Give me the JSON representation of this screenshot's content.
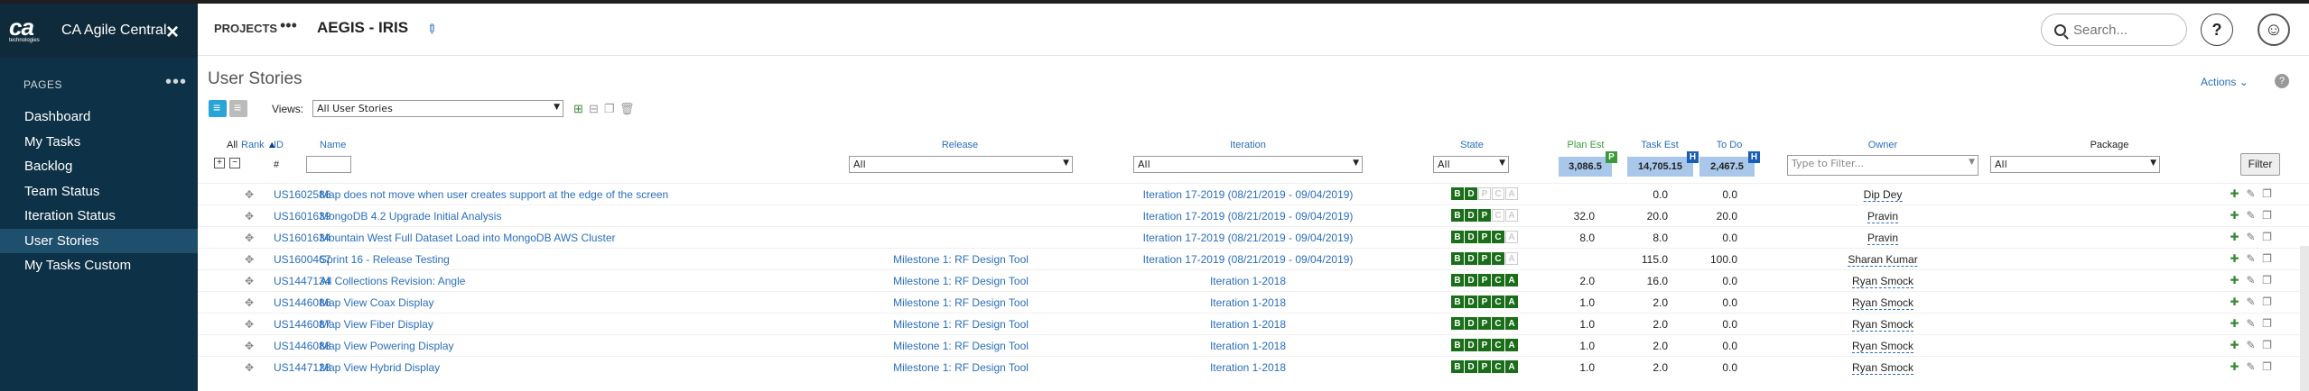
{
  "app": {
    "name": "CA Agile Central",
    "logo_text": "ca",
    "logo_subtext": "technologies"
  },
  "sidebar": {
    "heading": "PAGES",
    "items": [
      {
        "label": "Dashboard"
      },
      {
        "label": "My Tasks"
      },
      {
        "label": "Backlog"
      },
      {
        "label": "Team Status"
      },
      {
        "label": "Iteration Status"
      },
      {
        "label": "User Stories",
        "active": true
      },
      {
        "label": "My Tasks Custom"
      }
    ]
  },
  "header": {
    "projects_label": "PROJECTS",
    "project_title": "AEGIS - IRIS",
    "search_placeholder": "Search...",
    "help_label": "?"
  },
  "main": {
    "title": "User Stories",
    "actions_label": "Actions",
    "views_label": "Views:",
    "views_value": "All User Stories"
  },
  "columns": {
    "all": "All",
    "rank": "Rank",
    "id": "ID",
    "name": "Name",
    "release": "Release",
    "iteration": "Iteration",
    "state": "State",
    "plan_est": "Plan Est",
    "task_est": "Task Est",
    "to_do": "To Do",
    "owner": "Owner",
    "package": "Package"
  },
  "filters": {
    "id_prefix": "#",
    "release": "All",
    "iteration": "All",
    "state": "All",
    "owner_placeholder": "Type to Filter...",
    "package": "All",
    "filter_button": "Filter"
  },
  "totals": {
    "plan_est": "3,086.5",
    "task_est": "14,705.15",
    "to_do": "2,467.5",
    "plan_tag": "P",
    "task_tag": "H",
    "todo_tag": "H"
  },
  "state_letters": [
    "B",
    "D",
    "P",
    "C",
    "A"
  ],
  "colors": {
    "sidebar": "#0d3146",
    "accent": "#2a6ebb",
    "state_on": "#1a6e1a",
    "totals": "#a9c7ea"
  },
  "rows": [
    {
      "id": "US1602586",
      "name": "Map does not move when user creates support at the edge of the screen",
      "release": "",
      "iteration": "Iteration 17-2019 (08/21/2019 - 09/04/2019)",
      "state": 2,
      "plan_est": "",
      "task_est": "0.0",
      "to_do": "0.0",
      "owner": "Dip Dey"
    },
    {
      "id": "US1601639",
      "name": "MongoDB 4.2 Upgrade Initial Analysis",
      "release": "",
      "iteration": "Iteration 17-2019 (08/21/2019 - 09/04/2019)",
      "state": 3,
      "plan_est": "32.0",
      "task_est": "20.0",
      "to_do": "20.0",
      "owner": "Pravin"
    },
    {
      "id": "US1601634",
      "name": "Mountain West Full Dataset Load into MongoDB AWS Cluster",
      "release": "",
      "iteration": "Iteration 17-2019 (08/21/2019 - 09/04/2019)",
      "state": 4,
      "plan_est": "8.0",
      "task_est": "8.0",
      "to_do": "0.0",
      "owner": "Pravin"
    },
    {
      "id": "US1600467",
      "name": "Sprint 16 - Release Testing",
      "release": "Milestone 1: RF Design Tool",
      "iteration": "Iteration 17-2019 (08/21/2019 - 09/04/2019)",
      "state": 4,
      "plan_est": "",
      "task_est": "115.0",
      "to_do": "100.0",
      "owner": "Sharan Kumar"
    },
    {
      "id": "US1447134",
      "name": "All Collections Revision: Angle",
      "release": "Milestone 1: RF Design Tool",
      "iteration": "Iteration 1-2018",
      "state": 5,
      "plan_est": "2.0",
      "task_est": "16.0",
      "to_do": "0.0",
      "owner": "Ryan Smock"
    },
    {
      "id": "US1446086",
      "name": "Map View Coax Display",
      "release": "Milestone 1: RF Design Tool",
      "iteration": "Iteration 1-2018",
      "state": 5,
      "plan_est": "1.0",
      "task_est": "2.0",
      "to_do": "0.0",
      "owner": "Ryan Smock"
    },
    {
      "id": "US1446087",
      "name": "Map View Fiber Display",
      "release": "Milestone 1: RF Design Tool",
      "iteration": "Iteration 1-2018",
      "state": 5,
      "plan_est": "1.0",
      "task_est": "2.0",
      "to_do": "0.0",
      "owner": "Ryan Smock"
    },
    {
      "id": "US1446088",
      "name": "Map View Powering Display",
      "release": "Milestone 1: RF Design Tool",
      "iteration": "Iteration 1-2018",
      "state": 5,
      "plan_est": "1.0",
      "task_est": "2.0",
      "to_do": "0.0",
      "owner": "Ryan Smock"
    },
    {
      "id": "US1447128",
      "name": "Map View Hybrid Display",
      "release": "Milestone 1: RF Design Tool",
      "iteration": "Iteration 1-2018",
      "state": 5,
      "plan_est": "1.0",
      "task_est": "2.0",
      "to_do": "0.0",
      "owner": "Ryan Smock"
    }
  ]
}
